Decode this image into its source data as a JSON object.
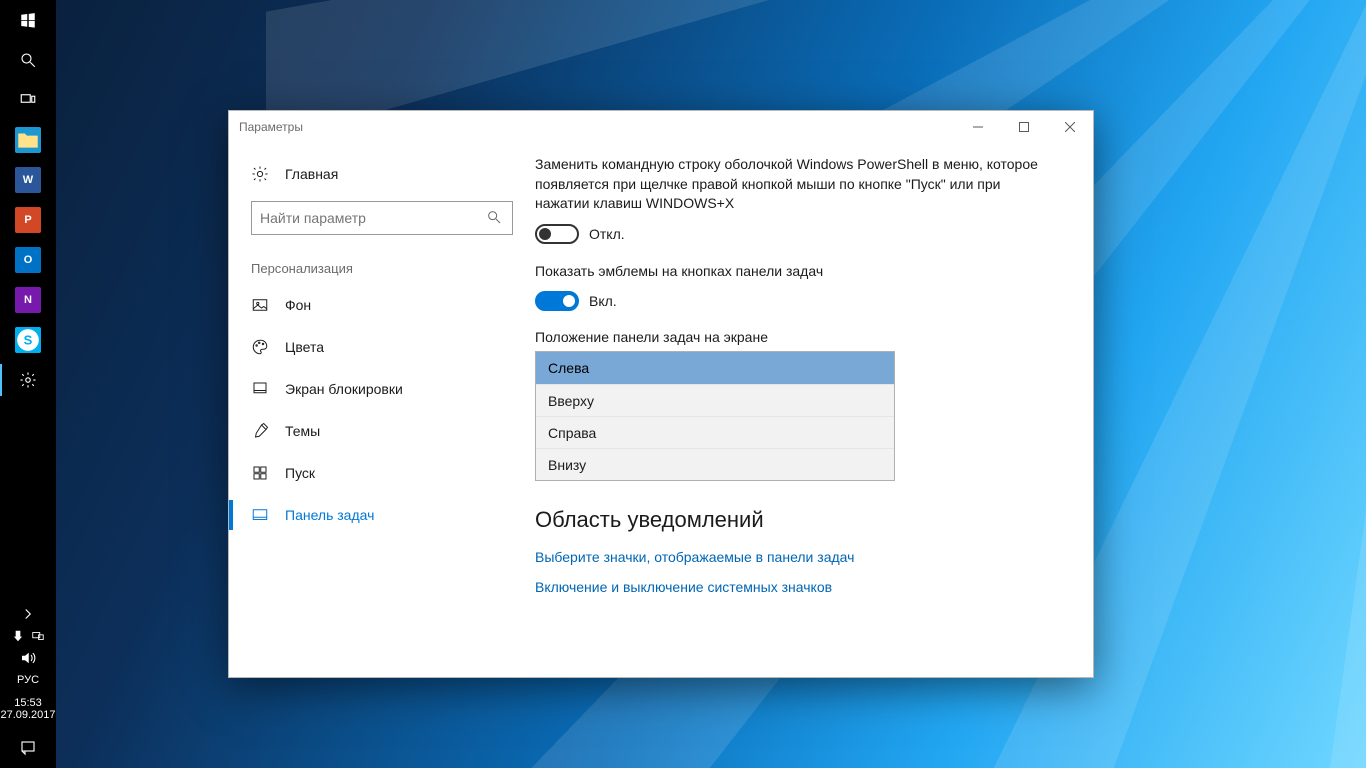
{
  "taskbar": {
    "language": "РУС",
    "time": "15:53",
    "date": "27.09.2017"
  },
  "window": {
    "title": "Параметры"
  },
  "side": {
    "home": "Главная",
    "search_placeholder": "Найти параметр",
    "section_label": "Персонализация",
    "items": {
      "background": "Фон",
      "colors": "Цвета",
      "lockscreen": "Экран блокировки",
      "themes": "Темы",
      "start": "Пуск",
      "taskbar": "Панель задач"
    }
  },
  "main": {
    "powershell_text": "Заменить командную строку оболочкой Windows PowerShell в меню, которое появляется при щелчке правой кнопкой мыши по кнопке \"Пуск\" или при нажатии клавиш WINDOWS+X",
    "powershell_state": "Откл.",
    "badges_text": "Показать эмблемы на кнопках панели задач",
    "badges_state": "Вкл.",
    "position_label": "Положение панели задач на экране",
    "position_options": {
      "left": "Слева",
      "top": "Вверху",
      "right": "Справа",
      "bottom": "Внизу"
    },
    "notif_heading": "Область уведомлений",
    "link_icons": "Выберите значки, отображаемые в панели задач",
    "link_systemicons": "Включение и выключение системных значков"
  }
}
